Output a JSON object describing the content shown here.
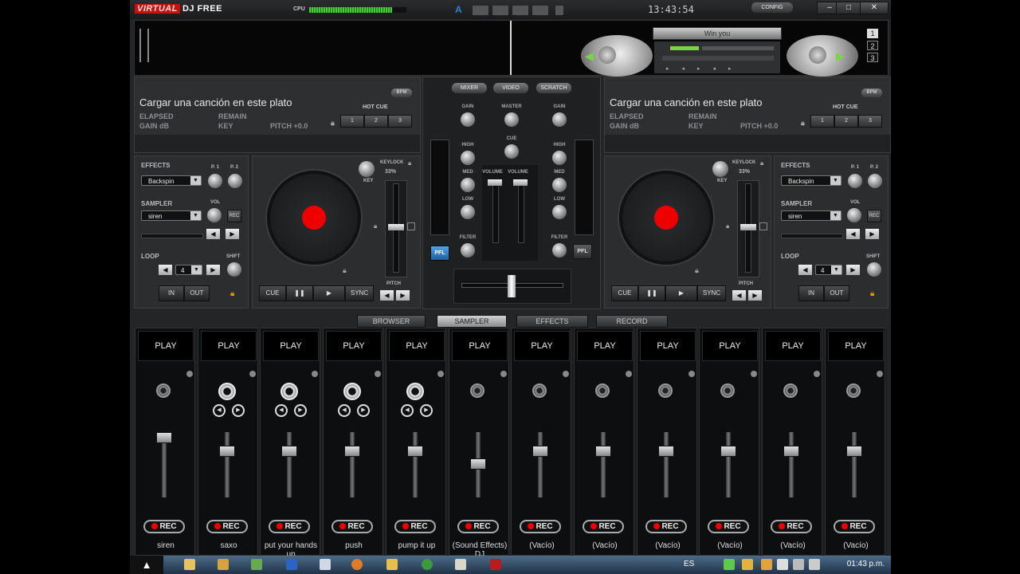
{
  "titlebar": {
    "logo_virtual": "VIRTUAL",
    "logo_dj": "DJ FREE",
    "cpu_label": "CPU",
    "cpu_load": 0.85,
    "mode_letter": "A",
    "clock": "13:43:54",
    "config_label": "CONFIG",
    "min": "–",
    "max": "□",
    "close": "✕"
  },
  "skin": {
    "track_display": "Win you",
    "layout_buttons": [
      "1",
      "2",
      "3"
    ]
  },
  "deck_left": {
    "title": "Cargar una canción en este plato",
    "bpm": "BPM",
    "elapsed": "ELAPSED",
    "remain": "REMAIN",
    "gain": "GAIN dB",
    "key": "KEY",
    "pitch": "PITCH +0.0",
    "hotcue": "HOT CUE",
    "hotcues": [
      "1",
      "2",
      "3"
    ],
    "effects_label": "EFFECTS",
    "p1": "P. 1",
    "p2": "P. 2",
    "effect_value": "Backspin",
    "sampler_label": "SAMPLER",
    "vol": "VOL",
    "rec": "REC",
    "sampler_value": "siren",
    "loop_label": "LOOP",
    "loop_value": "4",
    "shift": "SHIFT",
    "in": "IN",
    "out": "OUT",
    "keylock": "KEYLOCK",
    "keylock_value": "33%",
    "keylabel": "KEY",
    "cue": "CUE",
    "pause": "❚❚",
    "play": "▶",
    "sync": "SYNC",
    "pitch_label": "PITCH"
  },
  "deck_right": {
    "title": "Cargar una canción en este plato",
    "bpm": "BPM",
    "elapsed": "ELAPSED",
    "remain": "REMAIN",
    "gain": "GAIN dB",
    "key": "KEY",
    "pitch": "PITCH +0.0",
    "hotcue": "HOT CUE",
    "hotcues": [
      "1",
      "2",
      "3"
    ],
    "effects_label": "EFFECTS",
    "p1": "P. 1",
    "p2": "P. 2",
    "effect_value": "Backspin",
    "sampler_label": "SAMPLER",
    "vol": "VOL",
    "rec": "REC",
    "sampler_value": "siren",
    "loop_label": "LOOP",
    "loop_value": "4",
    "shift": "SHIFT",
    "in": "IN",
    "out": "OUT",
    "keylock": "KEYLOCK",
    "keylock_value": "33%",
    "keylabel": "KEY",
    "cue": "CUE",
    "pause": "❚❚",
    "play": "▶",
    "sync": "SYNC",
    "pitch_label": "PITCH"
  },
  "mixer": {
    "tabs": [
      "MIXER",
      "VIDEO",
      "SCRATCH"
    ],
    "gain": "GAIN",
    "master": "MASTER",
    "cue": "CUE",
    "high": "HIGH",
    "med": "MED",
    "low": "LOW",
    "volume": "VOLUME",
    "filter": "FILTER",
    "pfl": "PFL"
  },
  "bottom_tabs": [
    "BROWSER",
    "SAMPLER",
    "EFFECTS",
    "RECORD"
  ],
  "active_tab": "SAMPLER",
  "sampler_slots": [
    {
      "play": "PLAY",
      "rec": "REC",
      "name": "siren",
      "loaded": false
    },
    {
      "play": "PLAY",
      "rec": "REC",
      "name": "saxo",
      "loaded": true
    },
    {
      "play": "PLAY",
      "rec": "REC",
      "name": "put your hands up",
      "loaded": true
    },
    {
      "play": "PLAY",
      "rec": "REC",
      "name": "push",
      "loaded": true
    },
    {
      "play": "PLAY",
      "rec": "REC",
      "name": "pump it up",
      "loaded": true
    },
    {
      "play": "PLAY",
      "rec": "REC",
      "name": "(Sound Effects) DJ",
      "loaded": false
    },
    {
      "play": "PLAY",
      "rec": "REC",
      "name": "(Vacío)",
      "loaded": false
    },
    {
      "play": "PLAY",
      "rec": "REC",
      "name": "(Vacío)",
      "loaded": false
    },
    {
      "play": "PLAY",
      "rec": "REC",
      "name": "(Vacío)",
      "loaded": false
    },
    {
      "play": "PLAY",
      "rec": "REC",
      "name": "(Vacío)",
      "loaded": false
    },
    {
      "play": "PLAY",
      "rec": "REC",
      "name": "(Vacío)",
      "loaded": false
    },
    {
      "play": "PLAY",
      "rec": "REC",
      "name": "(Vacío)",
      "loaded": false
    }
  ],
  "taskbar": {
    "lang": "ES",
    "time": "01:43 p.m."
  },
  "colors": {
    "accent_red": "#e00000",
    "cpu_green": "#47d32d",
    "pfl_blue": "#2f7fc6"
  }
}
